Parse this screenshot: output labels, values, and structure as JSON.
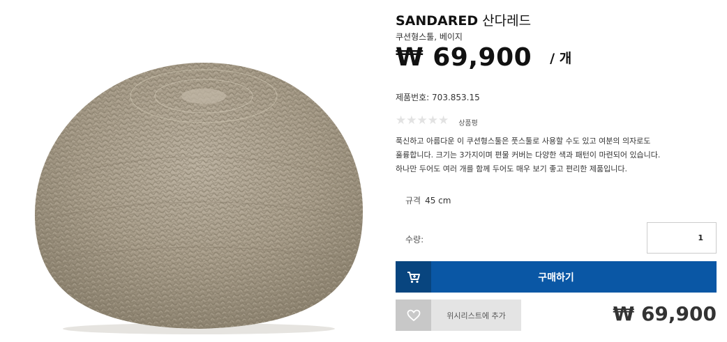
{
  "product": {
    "name_en": "SANDARED",
    "name_ko": "산다레드",
    "subtitle": "쿠션형스툴, 베이지",
    "price": "₩ 69,900",
    "unit": "/ 개",
    "article_label": "제품번호:",
    "article_number": "703.853.15",
    "stars": "★★★★★",
    "review_label": "상품평",
    "description": [
      "푹신하고 아름다운 이 쿠션형스툴은 풋스툴로 사용할 수도 있고 여분의 의자로도",
      "훌륭합니다. 크기는 3가지이며 편물 커버는 다양한 색과 패턴이 마련되어 있습니다.",
      "하나만 두어도 여러 개를 함께 두어도 매우 보기 좋고 편리한 제품입니다."
    ],
    "size_label": "규격",
    "size_value": "45 cm",
    "quantity_label": "수량:",
    "quantity_value": "1",
    "buy_label": "구매하기",
    "wishlist_label": "위시리스트에 추가",
    "bottom_price": "₩ 69,900"
  },
  "colors": {
    "buy_button": "#0a57a5",
    "cart_box": "#08457f",
    "wishlist_button": "#e4e4e4",
    "heart_box": "#c8c8c8",
    "product_beige": "#a59a88"
  },
  "icons": {
    "cart": "cart-icon",
    "heart": "heart-icon"
  }
}
